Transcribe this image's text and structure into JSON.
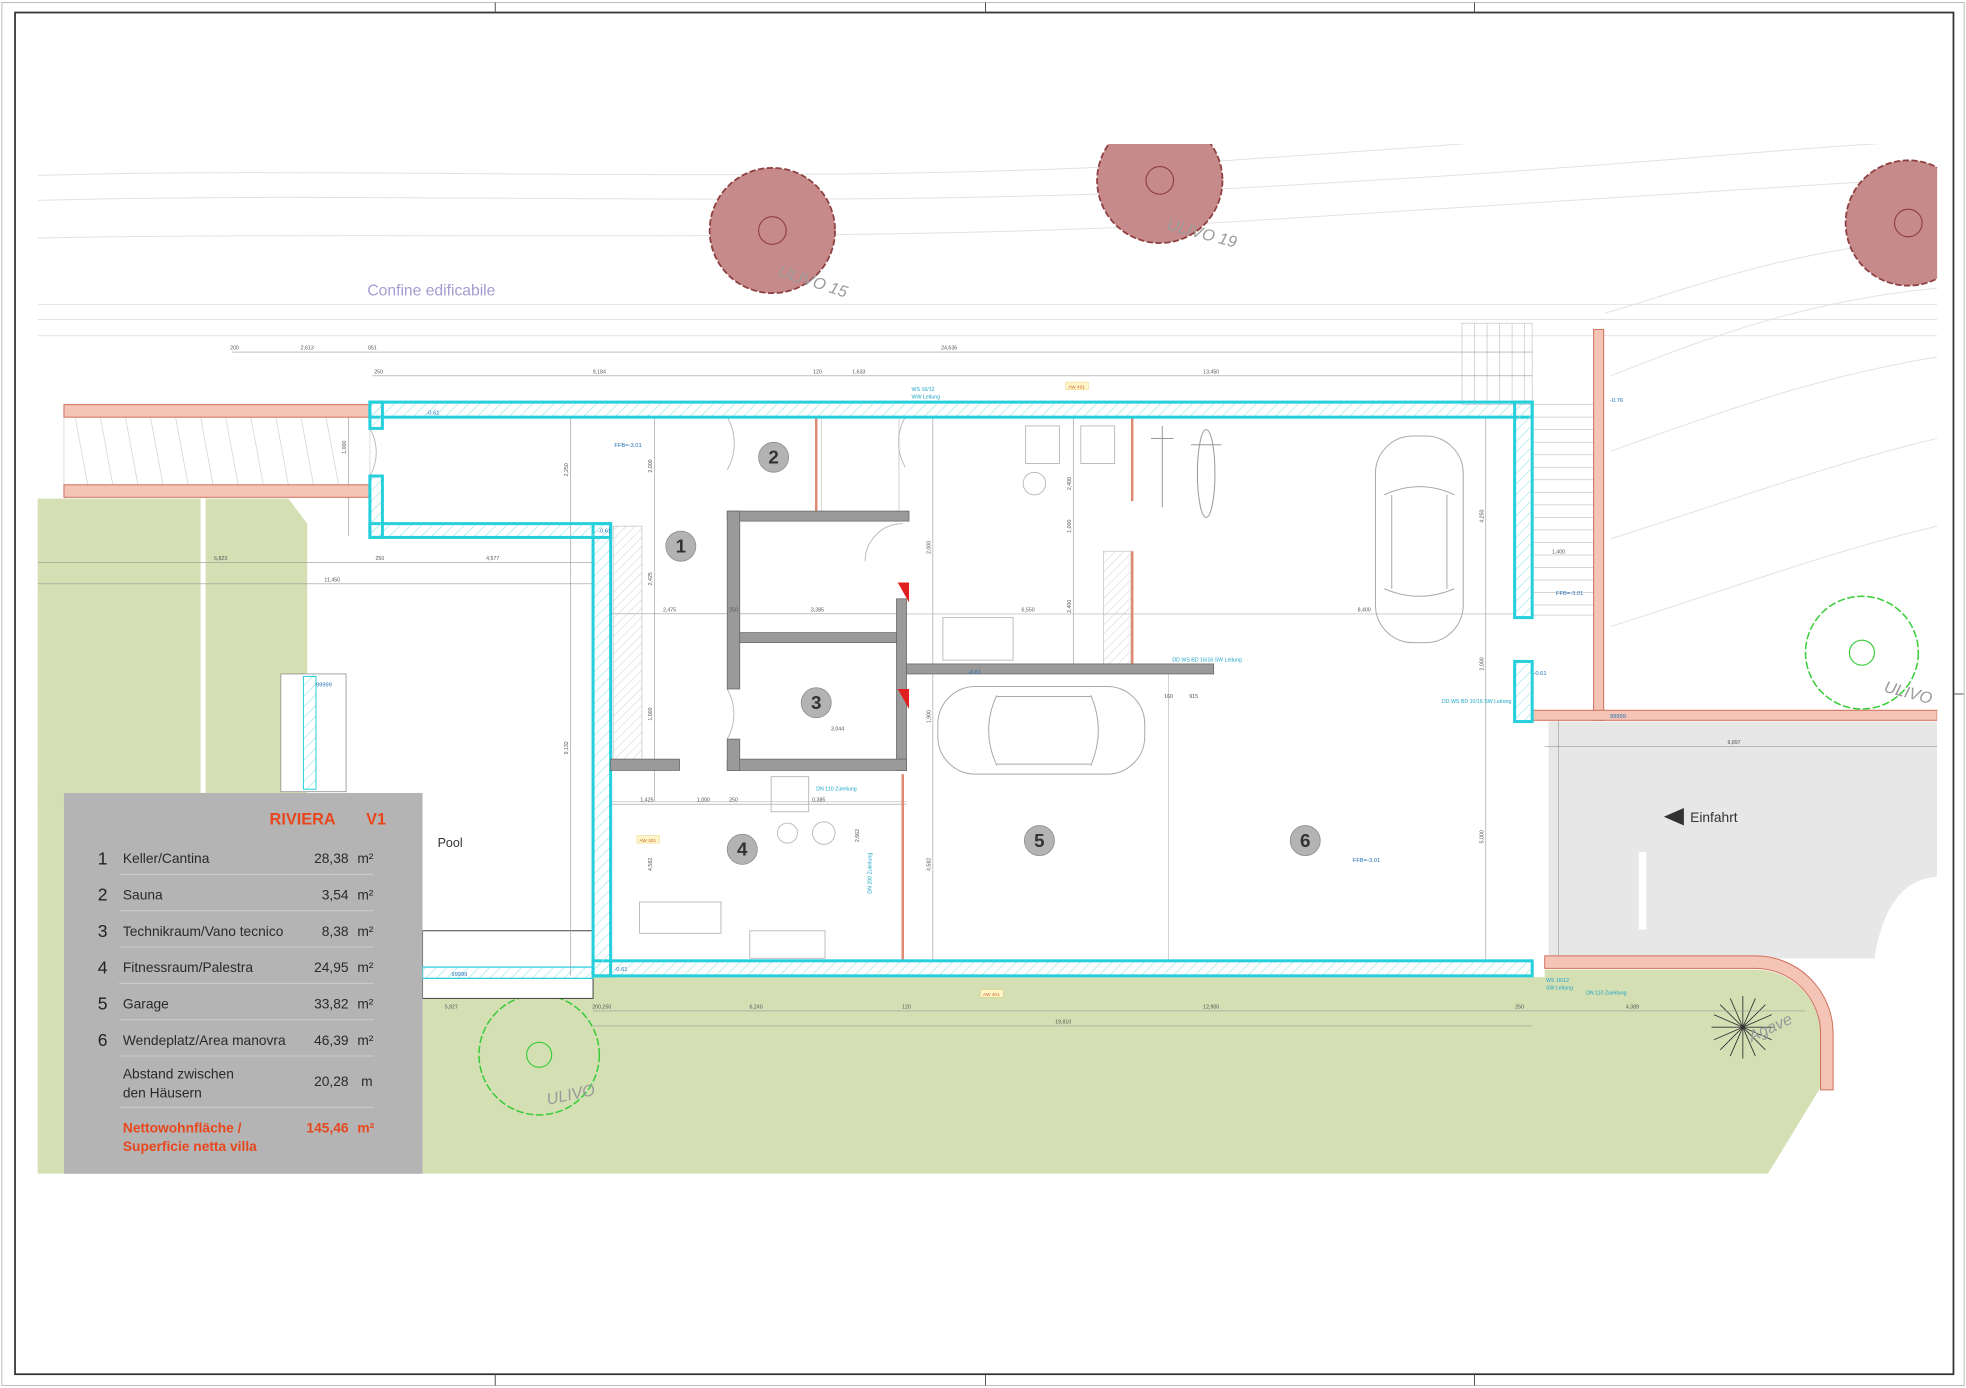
{
  "drawing": {
    "boundary_label": "Confine edificabile",
    "pool_label": "Pool",
    "entrance_label": "Einfahrt",
    "agave_label": "Agave",
    "tree_labels": [
      "ULIVO 15",
      "ULIVO 19",
      "ULIVO",
      "ULIVO"
    ]
  },
  "rooms": [
    {
      "number": "1"
    },
    {
      "number": "2"
    },
    {
      "number": "3"
    },
    {
      "number": "4"
    },
    {
      "number": "5"
    },
    {
      "number": "6"
    }
  ],
  "legend": {
    "title": "RIVIERA",
    "version": "V1",
    "rows": [
      {
        "num": "1",
        "name": "Keller/Cantina",
        "value": "28,38",
        "unit": "m²"
      },
      {
        "num": "2",
        "name": "Sauna",
        "value": "3,54",
        "unit": "m²"
      },
      {
        "num": "3",
        "name": "Technikraum/Vano tecnico",
        "value": "8,38",
        "unit": "m²"
      },
      {
        "num": "4",
        "name": "Fitnessraum/Palestra",
        "value": "24,95",
        "unit": "m²"
      },
      {
        "num": "5",
        "name": "Garage",
        "value": "33,82",
        "unit": "m²"
      },
      {
        "num": "6",
        "name": "Wendeplatz/Area manovra",
        "value": "46,39",
        "unit": "m²"
      }
    ],
    "distance": {
      "line1": "Abstand zwischen",
      "line2": "den Häusern",
      "value": "20,28",
      "unit": "m"
    },
    "total": {
      "line1": "Nettowohnfläche /",
      "line2": "Superficie netta villa",
      "value": "145,46",
      "unit": "m²"
    }
  },
  "dimensions": {
    "horizontal": [
      "200",
      "2,613",
      "051",
      "24,636",
      "250",
      "9,184",
      "120",
      "1,633",
      "13,450",
      "6,823",
      "250",
      "4,577",
      "11,450",
      "2,475",
      "250",
      "3,385",
      "6,550",
      "8,400",
      "1,425",
      "1,000",
      "250",
      "0,385",
      "3,044",
      "5,927",
      "200,250",
      "6,240",
      "120",
      "12,900",
      "250",
      "19,810",
      "9,897",
      "4,389",
      "160",
      "915",
      "1,400"
    ],
    "vertical": [
      "2,250",
      "9,132",
      "2,425",
      "2,000",
      "4,250",
      "2,000",
      "5,000",
      "1,000",
      "4,582",
      "2,662",
      "4,582",
      "2,000",
      "1,900",
      "2,400",
      "1,000",
      "2,400",
      "1,000"
    ]
  },
  "levels": [
    "FFB=-3.01",
    "-0.61",
    "-0.61",
    "-0.76",
    "FFB=-3.01",
    "-0.61",
    "-0.61",
    "FFB=-3.01",
    "-0.61",
    "99999",
    "99999",
    "99999"
  ],
  "pipes": [
    "WS 16/12",
    "WW Leitung",
    "DD WS BD 16/16 SW Leitung",
    "DD WS BD 10/16 SW Leitung",
    "DN 110 Zuleitung",
    "DN 200 Zuleitung",
    "WS 16/12",
    "SW Leitung",
    "DN 110 Zuleitung"
  ],
  "wall_tags": [
    "AW 401",
    "AW 401",
    "AW 401"
  ],
  "colors": {
    "lawn": "#d4dfb4",
    "driveway": "#e7e7e7",
    "wall_outer": "#25d0dc",
    "wall_outer_fill": "#c9f3f5",
    "wall_inner": "#9a9a9a",
    "wall_pink": "#f4c4b6",
    "tree_red": "#c78a8a",
    "tree_green": "#39cc39",
    "legend_bg": "#b4b4b4",
    "legend_accent": "#e8471e"
  }
}
